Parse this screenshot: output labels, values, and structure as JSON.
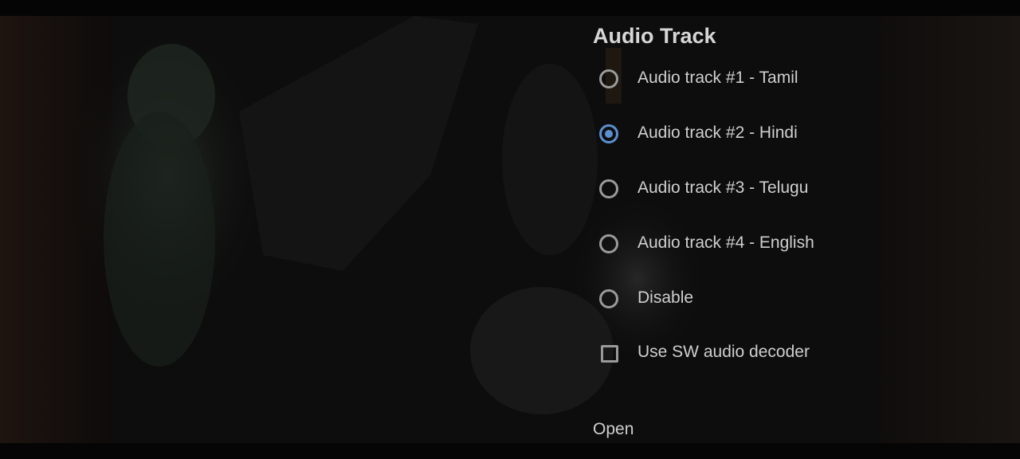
{
  "dialog": {
    "title": "Audio Track",
    "options": [
      {
        "label": "Audio track #1 - Tamil",
        "checked": false
      },
      {
        "label": "Audio track #2 - Hindi",
        "checked": true
      },
      {
        "label": "Audio track #3 - Telugu",
        "checked": false
      },
      {
        "label": "Audio track #4 - English",
        "checked": false
      },
      {
        "label": "Disable",
        "checked": false
      }
    ],
    "sw_decoder": {
      "label": "Use SW audio decoder",
      "checked": false
    },
    "open_label": "Open"
  },
  "colors": {
    "accent": "#5b8fd0",
    "text": "#cfcfcf",
    "title": "#d6d6d6",
    "control_border": "#9a9a9a"
  }
}
